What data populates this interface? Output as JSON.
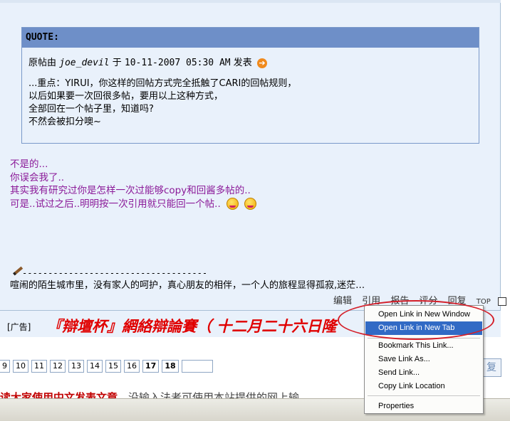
{
  "quote": {
    "header": "QUOTE:",
    "source_prefix": "原帖由",
    "author": "joe_devil",
    "source_at": "于",
    "datetime": "10-11-2007 05:30 AM",
    "source_suffix": "发表",
    "lines": [
      "...重点：YIRUI，你这样的回帖方式完全抵触了CARI的回帖规则，",
      "以后如果要一次回很多帖，要用以上这种方式，",
      "全部回在一个帖子里，知道吗?",
      "不然会被扣分噢~"
    ]
  },
  "reply": {
    "lines": [
      "不是的...",
      "你误会我了..",
      "其实我有研究过你是怎样一次过能够copy和回酱多帖的..",
      "可是..试过之后..明明按一次引用就只能回一个帖.."
    ]
  },
  "signature": {
    "dashes": "------------------------------------",
    "text": "喧闹的陌生城市里，没有家人的呵护，真心朋友的相伴，一个人的旅程显得孤寂,迷茫…"
  },
  "actions": {
    "edit": "编辑",
    "quote": "引用",
    "report": "报告",
    "rate": "评分",
    "reply": "回复",
    "top": "TOP"
  },
  "ad": {
    "label": "[广告]",
    "text": "『辯壇杯』網絡辯論賽（ 十二月二十六日隆"
  },
  "pager": {
    "pages": [
      "9",
      "10",
      "11",
      "12",
      "13",
      "14",
      "15",
      "16",
      "17",
      "18"
    ],
    "current": "18",
    "right_button": "复"
  },
  "bottom": {
    "red_text": "读大家使用中文发表文章",
    "gray_text": "，没输入法者可使用本站提供的网上输"
  },
  "context_menu": {
    "items": [
      {
        "label": "Open Link in New Window",
        "selected": false
      },
      {
        "label": "Open Link in New Tab",
        "selected": true
      },
      {
        "label": "Bookmark This Link...",
        "selected": false
      },
      {
        "label": "Save Link As...",
        "selected": false
      },
      {
        "label": "Send Link...",
        "selected": false
      },
      {
        "label": "Copy Link Location",
        "selected": false
      },
      {
        "label": "Properties",
        "selected": false
      }
    ]
  },
  "colors": {
    "quote_header": "#6e8fc8",
    "reply_text": "#8b1a99",
    "ad_text": "#e00000",
    "menu_highlight": "#316ac5",
    "annotation_ellipse": "#d4202a"
  },
  "icons": [
    "arrow-right-icon",
    "smiley-icon",
    "pencil-icon",
    "checkbox-icon"
  ]
}
